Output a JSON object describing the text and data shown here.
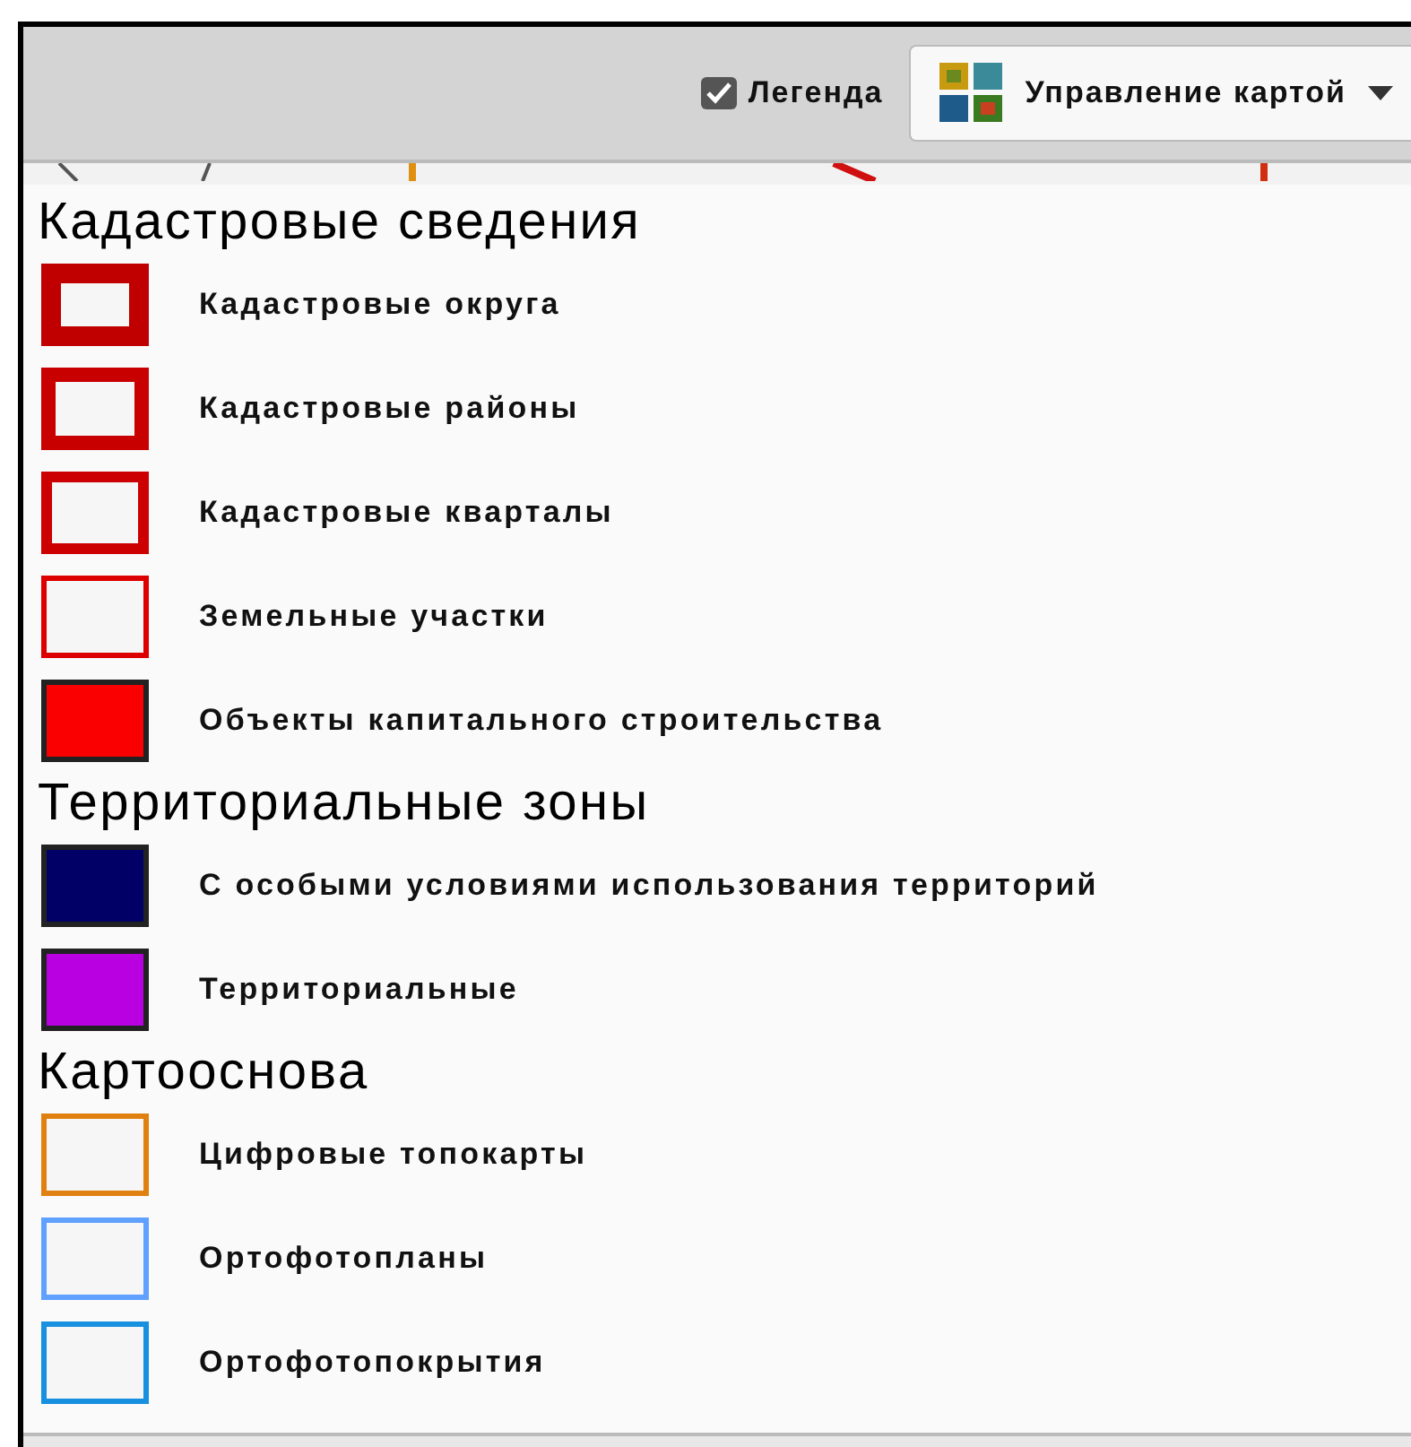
{
  "toolbar": {
    "legend_toggle": {
      "label": "Легенда",
      "checked": true
    },
    "map_control": {
      "label": "Управление картой"
    }
  },
  "legend": {
    "sections": [
      {
        "title": "Кадастровые сведения",
        "items": [
          {
            "label": "Кадастровые округа",
            "kind": "outline-heavy",
            "color": "#c00000"
          },
          {
            "label": "Кадастровые районы",
            "kind": "outline-bold",
            "color": "#c80000"
          },
          {
            "label": "Кадастровые кварталы",
            "kind": "outline",
            "color": "#cc0000"
          },
          {
            "label": "Земельные участки",
            "kind": "outline-thin",
            "color": "#dd0000"
          },
          {
            "label": "Объекты капитального строительства",
            "kind": "fill",
            "color": "#fa0000"
          }
        ]
      },
      {
        "title": "Территориальные зоны",
        "items": [
          {
            "label": "С особыми условиями использования территорий",
            "kind": "fill",
            "color": "#000066"
          },
          {
            "label": "Территориальные",
            "kind": "fill",
            "color": "#b800e0"
          }
        ]
      },
      {
        "title": "Картооснова",
        "items": [
          {
            "label": "Цифровые топокарты",
            "kind": "outline-thin",
            "color": "#e08010"
          },
          {
            "label": "Ортофотопланы",
            "kind": "outline-thin",
            "color": "#60a0ff"
          },
          {
            "label": "Ортофотопокрытия",
            "kind": "outline-thin",
            "color": "#1890e0"
          }
        ]
      }
    ]
  }
}
